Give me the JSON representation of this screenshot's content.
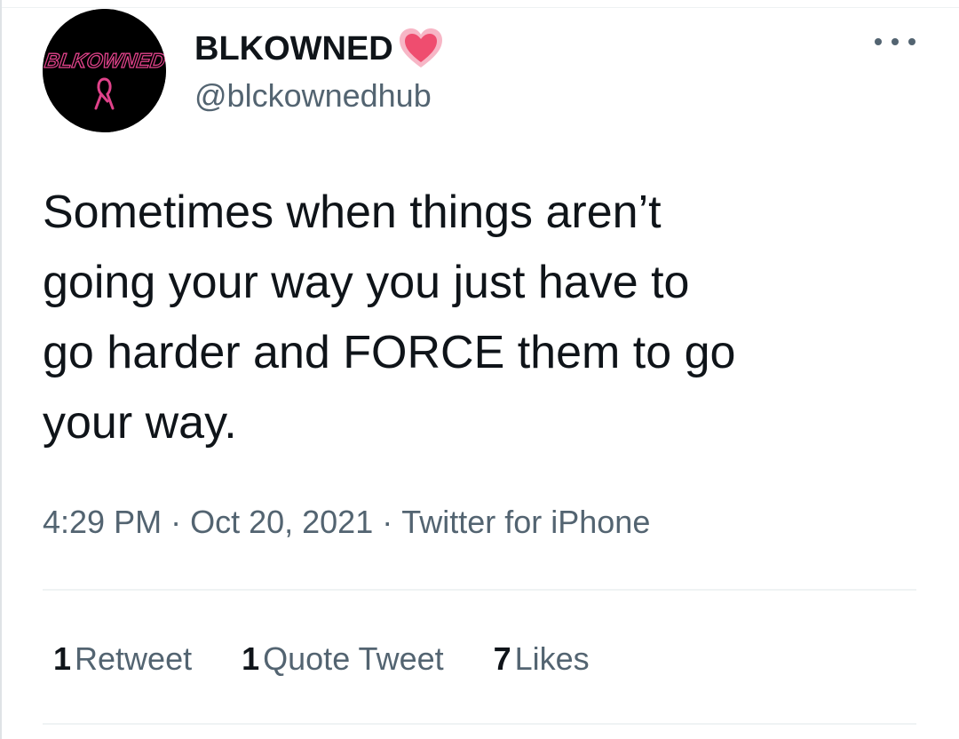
{
  "tweet": {
    "display_name": "BLKOWNED",
    "handle": "@blckownedhub",
    "avatar": {
      "text": "BLKOWNED",
      "icon": "awareness-ribbon-icon",
      "background": "#000000",
      "accent": "#e0428a"
    },
    "badge_icon": "sparkling-heart-icon",
    "more_icon": "more-options-icon",
    "text_lines": [
      "Sometimes when things aren’t",
      "going your way you just have to",
      "go harder and FORCE them to go",
      "your way."
    ],
    "time": "4:29 PM",
    "date": "Oct 20, 2021",
    "separator": "·",
    "source": "Twitter for iPhone",
    "stats": {
      "retweets": {
        "count": "1",
        "label": "Retweet"
      },
      "quotes": {
        "count": "1",
        "label": "Quote Tweet"
      },
      "likes": {
        "count": "7",
        "label": "Likes"
      }
    }
  },
  "colors": {
    "text": "#0f1419",
    "secondary": "#536471",
    "divider": "#eff3f4",
    "heart": "#f0506e"
  }
}
